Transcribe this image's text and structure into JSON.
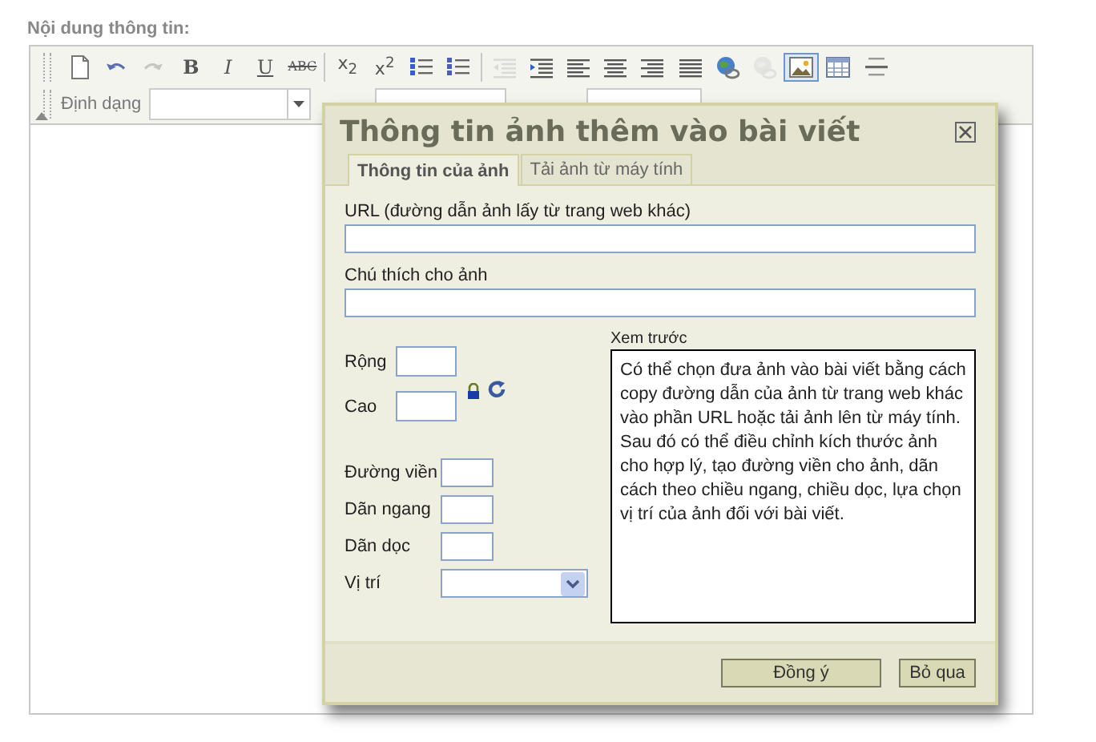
{
  "page_label": "Nội dung thông tin:",
  "toolbar": {
    "groups": [
      {
        "buttons": [
          {
            "kind": "new",
            "selected": false,
            "disabled": false
          },
          {
            "kind": "undo",
            "selected": false,
            "disabled": false
          },
          {
            "kind": "redo",
            "selected": false,
            "disabled": true
          },
          {
            "kind": "bold",
            "glyph": "B",
            "selected": false,
            "disabled": false
          },
          {
            "kind": "italic",
            "glyph": "I",
            "selected": false,
            "disabled": false
          },
          {
            "kind": "underline",
            "glyph": "U",
            "selected": false,
            "disabled": false
          },
          {
            "kind": "strike",
            "glyph": "ABC",
            "selected": false,
            "disabled": false
          }
        ]
      },
      {
        "buttons": [
          {
            "kind": "subscript",
            "glyph": "x$_{2}$",
            "selected": false,
            "disabled": false
          },
          {
            "kind": "superscript",
            "glyph": "x$^{2}$",
            "selected": false,
            "disabled": false
          },
          {
            "kind": "olist",
            "selected": false,
            "disabled": false
          },
          {
            "kind": "ulist",
            "selected": false,
            "disabled": false
          }
        ]
      },
      {
        "buttons": [
          {
            "kind": "outdent",
            "selected": false,
            "disabled": true
          },
          {
            "kind": "indent",
            "selected": false,
            "disabled": false
          },
          {
            "kind": "align-left",
            "selected": false,
            "disabled": false
          },
          {
            "kind": "align-center",
            "selected": false,
            "disabled": false
          },
          {
            "kind": "align-right",
            "selected": false,
            "disabled": false
          },
          {
            "kind": "justify",
            "selected": false,
            "disabled": false
          },
          {
            "kind": "link",
            "selected": false,
            "disabled": false
          },
          {
            "kind": "link",
            "selected": false,
            "disabled": true
          },
          {
            "kind": "image",
            "selected": true,
            "disabled": false
          },
          {
            "kind": "table",
            "selected": false,
            "disabled": false
          },
          {
            "kind": "rule",
            "selected": false,
            "disabled": false
          }
        ]
      }
    ],
    "format_label": "Định dạng"
  },
  "dialog": {
    "title": "Thông tin ảnh thêm vào bài viết",
    "tabs": [
      {
        "label": "Thông tin của ảnh",
        "selected": true
      },
      {
        "label": "Tải ảnh từ máy tính",
        "selected": false
      }
    ],
    "url_label": "URL (đường dẫn ảnh lấy từ trang web khác)",
    "caption_label": "Chú thích cho ảnh",
    "width_label": "Rộng",
    "height_label": "Cao",
    "border_label": "Đường viền",
    "hspace_label": "Dãn ngang",
    "vspace_label": "Dãn dọc",
    "align_label": "Vị trí",
    "preview_label": "Xem trước",
    "preview_text": "Có thể chọn đưa ảnh vào bài viết bằng cách copy đường dẫn của ảnh từ trang web khác vào phần URL hoặc tải ảnh lên từ máy tính. Sau đó có thể điều chỉnh kích thước ảnh cho hợp lý, tạo đường viền cho ảnh, dãn cách theo chiều ngang, chiều dọc, lựa chọn vị trí của ảnh đối với bài viết.",
    "buttons": [
      {
        "label": "Đồng ý",
        "kind": "primary"
      },
      {
        "label": "Bỏ qua",
        "kind": "secondary"
      }
    ]
  }
}
